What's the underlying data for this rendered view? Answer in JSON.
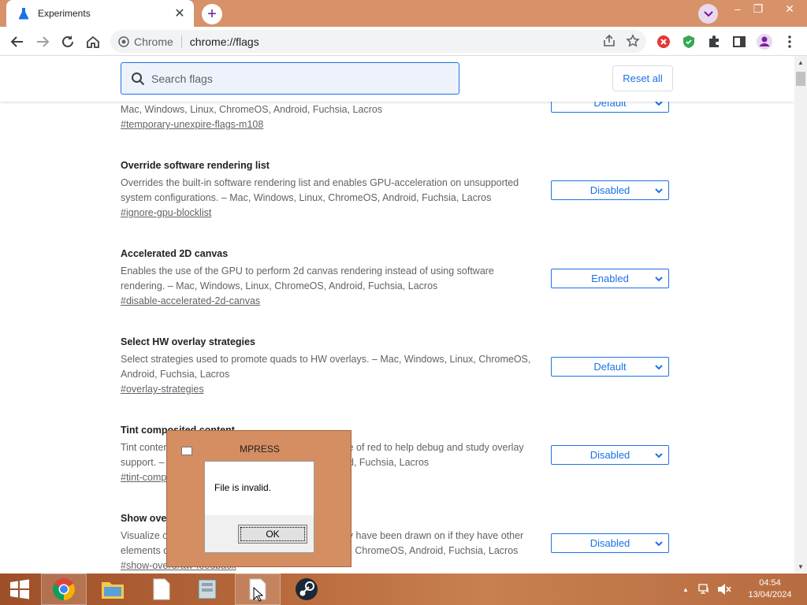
{
  "window": {
    "tab_title": "Experiments",
    "new_tab_symbol": "+",
    "controls": {
      "minimize": "–",
      "restore": "❐",
      "close": "✕"
    }
  },
  "toolbar": {
    "site_chip_label": "Chrome",
    "url": "chrome://flags"
  },
  "page": {
    "search_placeholder": "Search flags",
    "reset_label": "Reset all",
    "flags": [
      {
        "name": "",
        "description": "Mac, Windows, Linux, ChromeOS, Android, Fuchsia, Lacros",
        "link": "#temporary-unexpire-flags-m108",
        "value": "Default"
      },
      {
        "name": "Override software rendering list",
        "description": "Overrides the built-in software rendering list and enables GPU-acceleration on unsupported system configurations. – Mac, Windows, Linux, ChromeOS, Android, Fuchsia, Lacros",
        "link": "#ignore-gpu-blocklist",
        "value": "Disabled"
      },
      {
        "name": "Accelerated 2D canvas",
        "description": "Enables the use of the GPU to perform 2d canvas rendering instead of using software rendering. – Mac, Windows, Linux, ChromeOS, Android, Fuchsia, Lacros",
        "link": "#disable-accelerated-2d-canvas",
        "value": "Enabled"
      },
      {
        "name": "Select HW overlay strategies",
        "description": "Select strategies used to promote quads to HW overlays. – Mac, Windows, Linux, ChromeOS, Android, Fuchsia, Lacros",
        "link": "#overlay-strategies",
        "value": "Default"
      },
      {
        "name": "Tint composited content",
        "description": "Tint contents composited using overlays with a shade of red to help debug and study overlay support. – Mac, Windows, Linux, ChromeOS, Android, Fuchsia, Lacros",
        "link": "#tint-composited-content",
        "value": "Disabled"
      },
      {
        "name": "Show overdraw feedback",
        "description": "Visualize overdraw by coloring elements green if they have been drawn on if they have other elements drawn underneath. – Mac, Windows, Linux, ChromeOS, Android, Fuchsia, Lacros",
        "link": "#show-overdraw-feedback",
        "value": "Disabled"
      }
    ]
  },
  "dialog": {
    "title": "MPRESS",
    "message": "File is invalid.",
    "ok_label": "OK"
  },
  "taskbar": {
    "clock_time": "04:54",
    "clock_date": "13/04/2024"
  },
  "colors": {
    "accent": "#1a73e8",
    "frame": "#d7926a",
    "dialog_bg": "#d58d62"
  }
}
